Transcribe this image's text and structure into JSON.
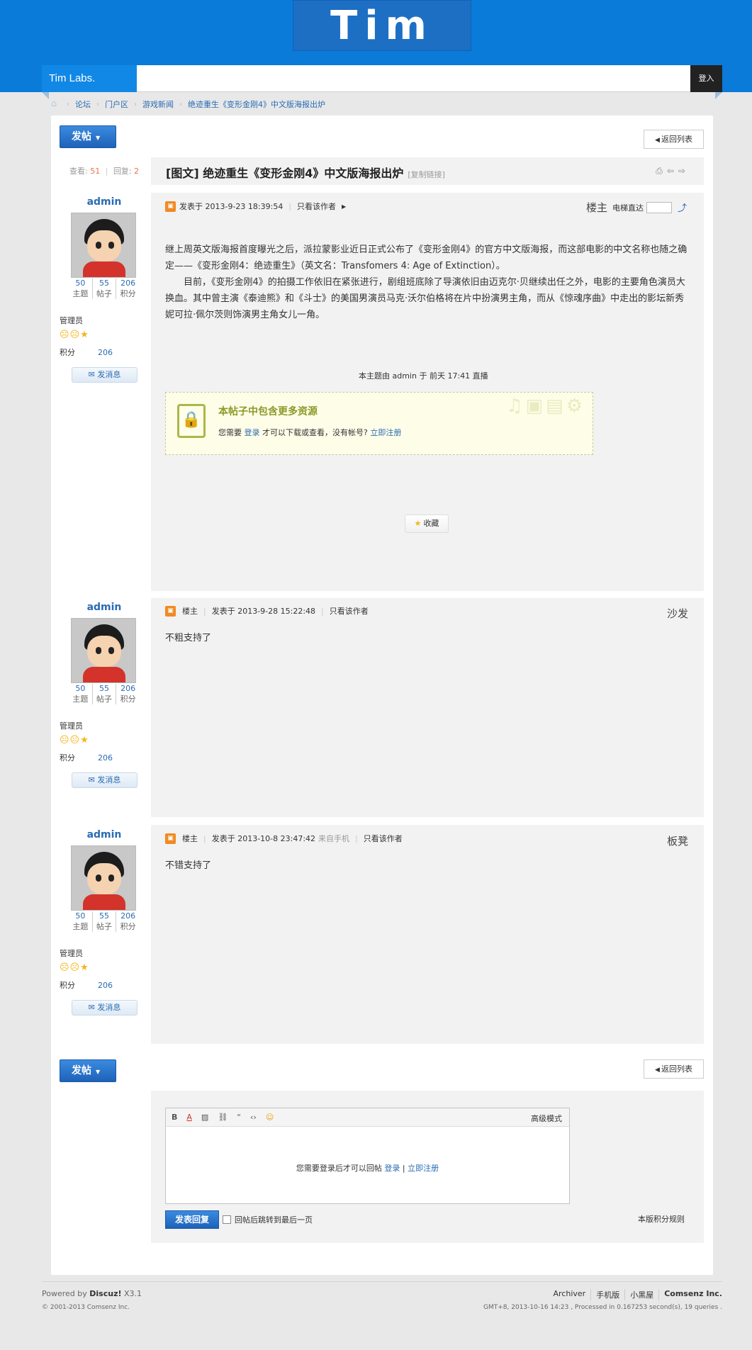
{
  "header": {
    "logo_text": "Tim",
    "site_name": "Tim Labs.",
    "login_label": "登入"
  },
  "breadcrumb": [
    "论坛",
    "门户区",
    "游戏新闻",
    "绝迹重生《变形金刚4》中文版海报出炉"
  ],
  "toolbar": {
    "post_label": "发帖",
    "back_label": "返回列表"
  },
  "stats": {
    "views_label": "查看:",
    "views": "51",
    "replies_label": "回复:",
    "replies": "2"
  },
  "thread": {
    "title": "[图文] 绝迹重生《变形金刚4》中文版海报出炉",
    "copy_link": "[复制链接]"
  },
  "author": {
    "name": "admin",
    "topics": "50",
    "posts": "55",
    "points": "206",
    "topics_label": "主题",
    "posts_label": "帖子",
    "points_label": "积分",
    "role": "管理员",
    "points_row_label": "积分",
    "message_label": "发消息"
  },
  "posts": [
    {
      "badge": "",
      "posted": "发表于 2013-9-23 18:39:54",
      "mobile": "",
      "author_only": "只看该作者",
      "floor": "楼主",
      "paragraphs": [
        "继上周英文版海报首度曝光之后，派拉蒙影业近日正式公布了《变形金刚4》的官方中文版海报，而这部电影的中文名称也随之确定——《变形金刚4：绝迹重生》（英文名：Transfomers 4: Age of Extinction）。",
        "　　目前，《变形金刚4》的拍摄工作依旧在紧张进行，剧组班底除了导演依旧由迈克尔·贝继续出任之外，电影的主要角色演员大换血。其中曾主演《泰迪熊》和《斗士》的美国男演员马克·沃尔伯格将在片中扮演男主角，而从《惊魂序曲》中走出的影坛新秀妮可拉·佩尔茨则饰演男主角女儿一角。"
      ],
      "elevator_label": "电梯直达",
      "direct_by": "本主题由 admin 于 前天 17:41 直播",
      "resource": {
        "title": "本帖子中包含更多资源",
        "prefix": "您需要",
        "login": "登录",
        "middle": "才可以下载或查看，没有帐号?",
        "register": "立即注册"
      },
      "favorite_label": "收藏"
    },
    {
      "badge": "楼主",
      "posted": "发表于 2013-9-28 15:22:48",
      "mobile": "",
      "author_only": "只看该作者",
      "floor": "沙发",
      "paragraphs": [
        "不粗支持了"
      ]
    },
    {
      "badge": "楼主",
      "posted": "发表于 2013-10-8 23:47:42",
      "mobile": "来自手机",
      "author_only": "只看该作者",
      "floor": "板凳",
      "paragraphs": [
        "不错支持了"
      ]
    }
  ],
  "editor": {
    "advanced": "高级模式",
    "login_prefix": "您需要登录后才可以回帖",
    "login": "登录",
    "sep": "|",
    "register": "立即注册",
    "submit": "发表回复",
    "jump_last": "回帖后跳转到最后一页",
    "rules": "本版积分规则"
  },
  "footer": {
    "powered_prefix": "Powered by",
    "powered_brand": "Discuz!",
    "powered_ver": "X3.1",
    "copyright": "© 2001-2013 Comsenz Inc.",
    "links": [
      "Archiver",
      "手机版",
      "小黑屋",
      "Comsenz Inc."
    ],
    "gmt": "GMT+8, 2013-10-16 14:23 , Processed in 0.167253 second(s), 19 queries ."
  }
}
